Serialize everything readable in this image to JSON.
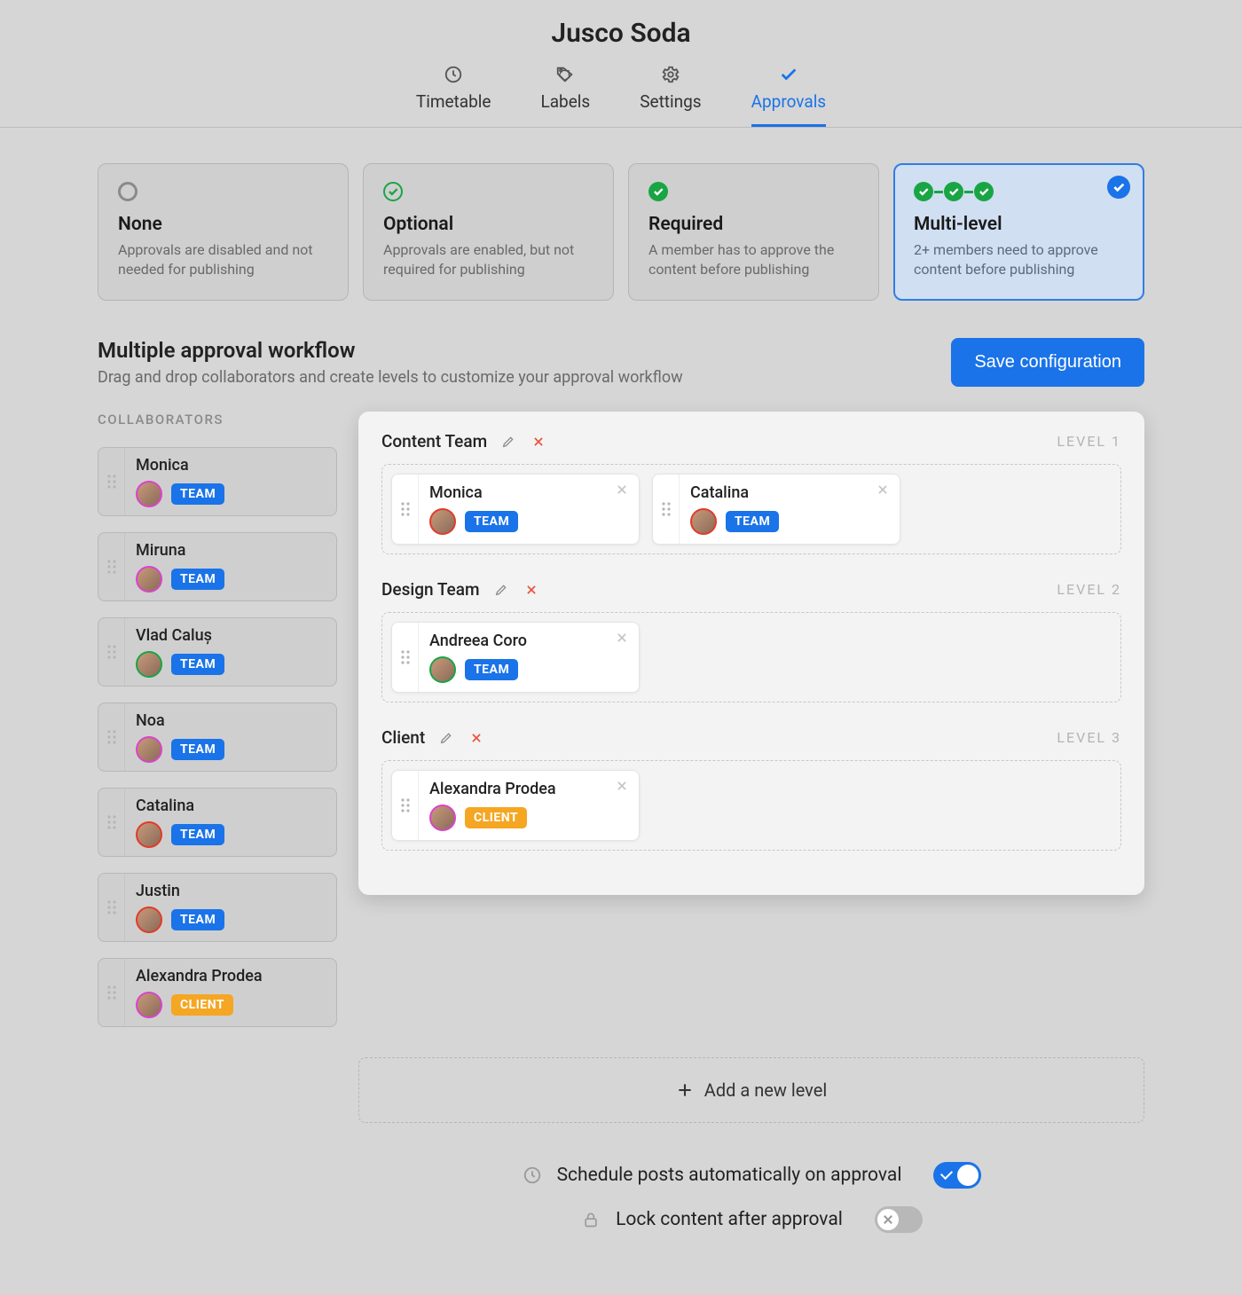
{
  "header": {
    "title": "Jusco Soda",
    "tabs": [
      {
        "label": "Timetable",
        "icon": "clock-icon",
        "active": false
      },
      {
        "label": "Labels",
        "icon": "tag-icon",
        "active": false
      },
      {
        "label": "Settings",
        "icon": "gear-icon",
        "active": false
      },
      {
        "label": "Approvals",
        "icon": "check-icon",
        "active": true
      }
    ]
  },
  "modes": [
    {
      "key": "none",
      "title": "None",
      "desc": "Approvals are disabled and not needed for publishing",
      "selected": false
    },
    {
      "key": "optional",
      "title": "Optional",
      "desc": "Approvals are enabled, but not required for publishing",
      "selected": false
    },
    {
      "key": "required",
      "title": "Required",
      "desc": "A member has to approve the content before publishing",
      "selected": false
    },
    {
      "key": "multi",
      "title": "Multi-level",
      "desc": "2+ members need to approve content before publishing",
      "selected": true
    }
  ],
  "section": {
    "title": "Multiple approval workflow",
    "sub": "Drag and drop collaborators and create levels to customize your approval workflow",
    "save_label": "Save configuration"
  },
  "collaborators": {
    "heading": "COLLABORATORS",
    "items": [
      {
        "name": "Monica",
        "role": "TEAM",
        "avatar_ring": "#d845c9"
      },
      {
        "name": "Miruna",
        "role": "TEAM",
        "avatar_ring": "#d845c9"
      },
      {
        "name": "Vlad Caluș",
        "role": "TEAM",
        "avatar_ring": "#19a544"
      },
      {
        "name": "Noa",
        "role": "TEAM",
        "avatar_ring": "#d845c9"
      },
      {
        "name": "Catalina",
        "role": "TEAM",
        "avatar_ring": "#e13b2a"
      },
      {
        "name": "Justin",
        "role": "TEAM",
        "avatar_ring": "#e13b2a"
      },
      {
        "name": "Alexandra Prodea",
        "role": "CLIENT",
        "avatar_ring": "#d845c9"
      }
    ]
  },
  "levels": [
    {
      "name": "Content Team",
      "tag": "LEVEL 1",
      "members": [
        {
          "name": "Monica",
          "role": "TEAM",
          "avatar_ring": "#e13b2a"
        },
        {
          "name": "Catalina",
          "role": "TEAM",
          "avatar_ring": "#e13b2a"
        }
      ]
    },
    {
      "name": "Design Team",
      "tag": "LEVEL 2",
      "members": [
        {
          "name": "Andreea Coro",
          "role": "TEAM",
          "avatar_ring": "#19a544"
        }
      ]
    },
    {
      "name": "Client",
      "tag": "LEVEL 3",
      "members": [
        {
          "name": "Alexandra Prodea",
          "role": "CLIENT",
          "avatar_ring": "#d845c9"
        }
      ]
    }
  ],
  "add_level_label": "Add a new level",
  "toggles": [
    {
      "icon": "clock-icon",
      "label": "Schedule posts automatically on approval",
      "on": true
    },
    {
      "icon": "lock-icon",
      "label": "Lock content after approval",
      "on": false
    }
  ],
  "colors": {
    "primary": "#1a73e8",
    "green": "#19a544",
    "orange": "#f5a623",
    "danger": "#e8553f"
  }
}
